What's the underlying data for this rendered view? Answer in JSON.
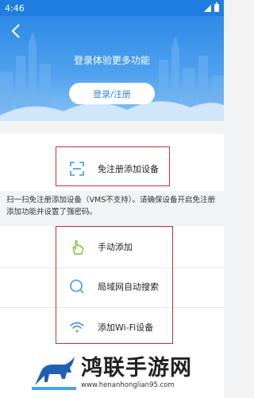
{
  "status_bar": {
    "time": "4:46"
  },
  "header": {
    "title": "登录体验更多功能",
    "login_button": "登录/注册"
  },
  "register_free": {
    "label": "免注册添加设备",
    "icon": "scan-frame-icon"
  },
  "hint": "扫一扫免注册添加设备（VMS不支持）。请确保设备开启免注册添加功能并设置了强密码。",
  "add_options": [
    {
      "label": "手动添加",
      "icon": "hand-pointer-icon"
    },
    {
      "label": "局域网自动搜索",
      "icon": "search-icon"
    },
    {
      "label": "添加Wi-Fi设备",
      "icon": "wifi-icon"
    }
  ],
  "watermark": {
    "brand": "鸿联手游网",
    "url": "www.henanhonglian95.com"
  },
  "colors": {
    "primary": "#2e8ae6",
    "accent_green": "#7cc43b",
    "highlight_red": "#d9283a"
  }
}
